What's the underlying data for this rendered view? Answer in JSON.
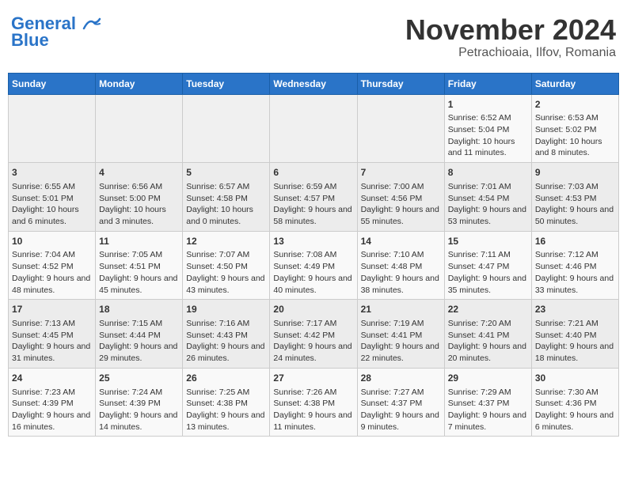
{
  "header": {
    "logo_line1": "General",
    "logo_line2": "Blue",
    "month_title": "November 2024",
    "subtitle": "Petrachioaia, Ilfov, Romania"
  },
  "days_of_week": [
    "Sunday",
    "Monday",
    "Tuesday",
    "Wednesday",
    "Thursday",
    "Friday",
    "Saturday"
  ],
  "weeks": [
    [
      {
        "day": "",
        "info": ""
      },
      {
        "day": "",
        "info": ""
      },
      {
        "day": "",
        "info": ""
      },
      {
        "day": "",
        "info": ""
      },
      {
        "day": "",
        "info": ""
      },
      {
        "day": "1",
        "info": "Sunrise: 6:52 AM\nSunset: 5:04 PM\nDaylight: 10 hours and 11 minutes."
      },
      {
        "day": "2",
        "info": "Sunrise: 6:53 AM\nSunset: 5:02 PM\nDaylight: 10 hours and 8 minutes."
      }
    ],
    [
      {
        "day": "3",
        "info": "Sunrise: 6:55 AM\nSunset: 5:01 PM\nDaylight: 10 hours and 6 minutes."
      },
      {
        "day": "4",
        "info": "Sunrise: 6:56 AM\nSunset: 5:00 PM\nDaylight: 10 hours and 3 minutes."
      },
      {
        "day": "5",
        "info": "Sunrise: 6:57 AM\nSunset: 4:58 PM\nDaylight: 10 hours and 0 minutes."
      },
      {
        "day": "6",
        "info": "Sunrise: 6:59 AM\nSunset: 4:57 PM\nDaylight: 9 hours and 58 minutes."
      },
      {
        "day": "7",
        "info": "Sunrise: 7:00 AM\nSunset: 4:56 PM\nDaylight: 9 hours and 55 minutes."
      },
      {
        "day": "8",
        "info": "Sunrise: 7:01 AM\nSunset: 4:54 PM\nDaylight: 9 hours and 53 minutes."
      },
      {
        "day": "9",
        "info": "Sunrise: 7:03 AM\nSunset: 4:53 PM\nDaylight: 9 hours and 50 minutes."
      }
    ],
    [
      {
        "day": "10",
        "info": "Sunrise: 7:04 AM\nSunset: 4:52 PM\nDaylight: 9 hours and 48 minutes."
      },
      {
        "day": "11",
        "info": "Sunrise: 7:05 AM\nSunset: 4:51 PM\nDaylight: 9 hours and 45 minutes."
      },
      {
        "day": "12",
        "info": "Sunrise: 7:07 AM\nSunset: 4:50 PM\nDaylight: 9 hours and 43 minutes."
      },
      {
        "day": "13",
        "info": "Sunrise: 7:08 AM\nSunset: 4:49 PM\nDaylight: 9 hours and 40 minutes."
      },
      {
        "day": "14",
        "info": "Sunrise: 7:10 AM\nSunset: 4:48 PM\nDaylight: 9 hours and 38 minutes."
      },
      {
        "day": "15",
        "info": "Sunrise: 7:11 AM\nSunset: 4:47 PM\nDaylight: 9 hours and 35 minutes."
      },
      {
        "day": "16",
        "info": "Sunrise: 7:12 AM\nSunset: 4:46 PM\nDaylight: 9 hours and 33 minutes."
      }
    ],
    [
      {
        "day": "17",
        "info": "Sunrise: 7:13 AM\nSunset: 4:45 PM\nDaylight: 9 hours and 31 minutes."
      },
      {
        "day": "18",
        "info": "Sunrise: 7:15 AM\nSunset: 4:44 PM\nDaylight: 9 hours and 29 minutes."
      },
      {
        "day": "19",
        "info": "Sunrise: 7:16 AM\nSunset: 4:43 PM\nDaylight: 9 hours and 26 minutes."
      },
      {
        "day": "20",
        "info": "Sunrise: 7:17 AM\nSunset: 4:42 PM\nDaylight: 9 hours and 24 minutes."
      },
      {
        "day": "21",
        "info": "Sunrise: 7:19 AM\nSunset: 4:41 PM\nDaylight: 9 hours and 22 minutes."
      },
      {
        "day": "22",
        "info": "Sunrise: 7:20 AM\nSunset: 4:41 PM\nDaylight: 9 hours and 20 minutes."
      },
      {
        "day": "23",
        "info": "Sunrise: 7:21 AM\nSunset: 4:40 PM\nDaylight: 9 hours and 18 minutes."
      }
    ],
    [
      {
        "day": "24",
        "info": "Sunrise: 7:23 AM\nSunset: 4:39 PM\nDaylight: 9 hours and 16 minutes."
      },
      {
        "day": "25",
        "info": "Sunrise: 7:24 AM\nSunset: 4:39 PM\nDaylight: 9 hours and 14 minutes."
      },
      {
        "day": "26",
        "info": "Sunrise: 7:25 AM\nSunset: 4:38 PM\nDaylight: 9 hours and 13 minutes."
      },
      {
        "day": "27",
        "info": "Sunrise: 7:26 AM\nSunset: 4:38 PM\nDaylight: 9 hours and 11 minutes."
      },
      {
        "day": "28",
        "info": "Sunrise: 7:27 AM\nSunset: 4:37 PM\nDaylight: 9 hours and 9 minutes."
      },
      {
        "day": "29",
        "info": "Sunrise: 7:29 AM\nSunset: 4:37 PM\nDaylight: 9 hours and 7 minutes."
      },
      {
        "day": "30",
        "info": "Sunrise: 7:30 AM\nSunset: 4:36 PM\nDaylight: 9 hours and 6 minutes."
      }
    ]
  ]
}
